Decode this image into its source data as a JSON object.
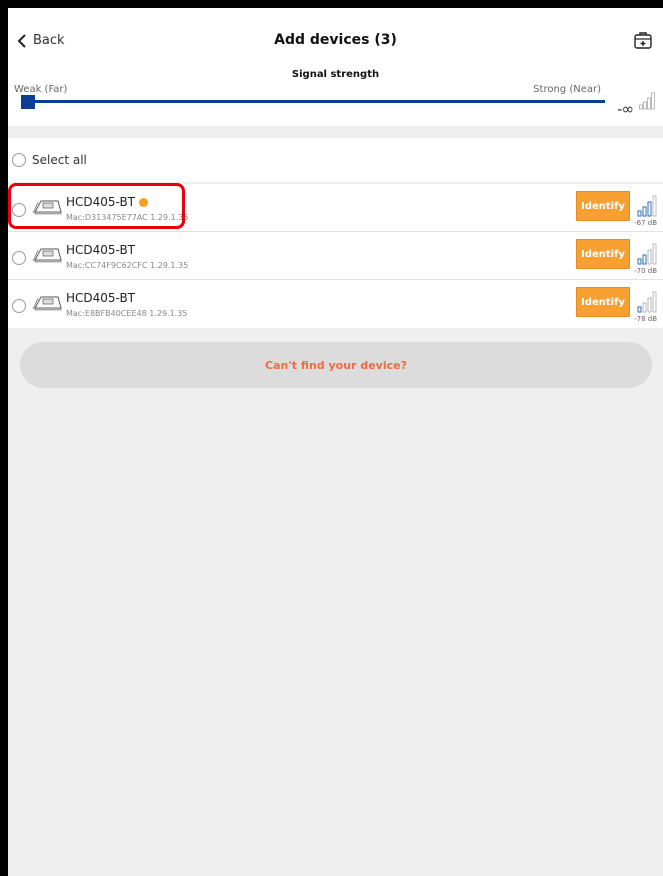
{
  "header": {
    "back_label": "Back",
    "title": "Add devices (3)"
  },
  "signal": {
    "title": "Signal strength",
    "weak_label": "Weak (Far)",
    "strong_label": "Strong (Near)",
    "threshold_label": "-∞",
    "slider_value": 0
  },
  "select_all_label": "Select all",
  "devices": [
    {
      "name": "HCD405-BT",
      "mac": "Mac:D313475E77AC  1.29.1.35",
      "identify_label": "Identify",
      "signal": "-67 dB",
      "connected_dot": true
    },
    {
      "name": "HCD405-BT",
      "mac": "Mac:CC74F9C62CFC  1.29.1.35",
      "identify_label": "Identify",
      "signal": "-70 dB",
      "connected_dot": false
    },
    {
      "name": "HCD405-BT",
      "mac": "Mac:E8BFB40CEE48  1.29.1.35",
      "identify_label": "Identify",
      "signal": "-78 dB",
      "connected_dot": false
    }
  ],
  "cant_find_label": "Can't find your device?",
  "colors": {
    "accent_orange": "#f7a031",
    "slider_blue": "#0c3d94",
    "highlight_red": "#e8000e",
    "link_orange": "#f06a41"
  }
}
